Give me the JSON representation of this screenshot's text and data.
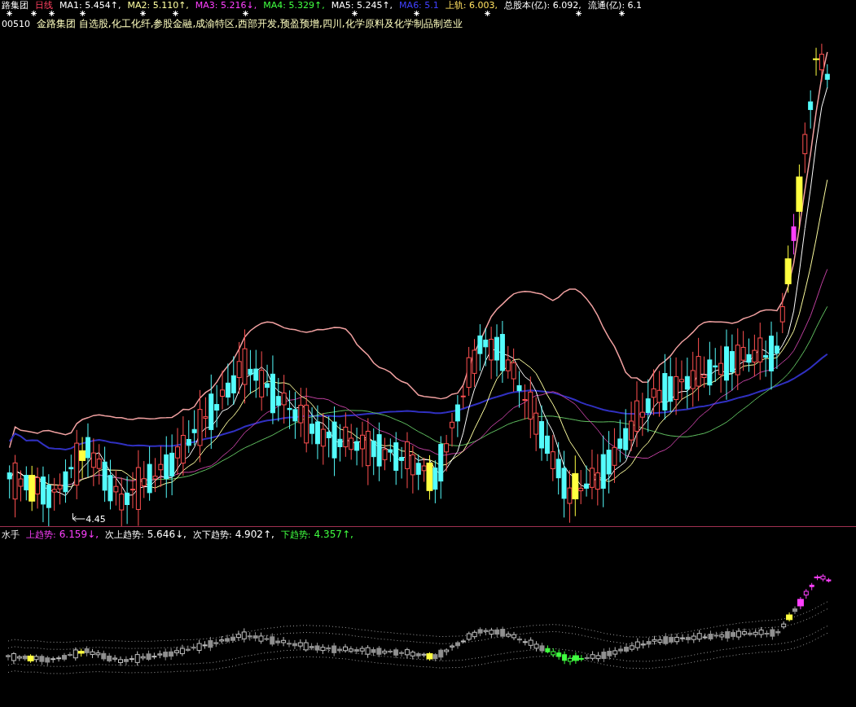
{
  "legend": {
    "title": "路集团",
    "period": "日线",
    "items": [
      {
        "text": "MA1: 5.454↑,",
        "color": "#ffffff"
      },
      {
        "text": "MA2: 5.110↑,",
        "color": "#ffffa0"
      },
      {
        "text": "MA3: 5.216↓,",
        "color": "#ff40ff"
      },
      {
        "text": "MA4: 5.329↑,",
        "color": "#40ff40"
      },
      {
        "text": "MA5: 5.245↑,",
        "color": "#ffffff"
      },
      {
        "text": "MA6: 5.1",
        "color": "#4040ff"
      },
      {
        "text": "上轨: 6.003,",
        "color": "#ffe060"
      },
      {
        "text": "总股本(亿): 6.092,",
        "color": "#ffffff"
      },
      {
        "text": "流通(亿): 6.1",
        "color": "#ffffff"
      }
    ]
  },
  "info": {
    "code": "00510",
    "text": "金路集团 自选股,化工化纤,参股金融,成渝特区,西部开发,预盈预增,四川,化学原料及化学制品制造业"
  },
  "price_marker": "4.45",
  "indicator": {
    "name": "水手",
    "items": [
      {
        "label": "上趋势:",
        "value": "6.159↓,",
        "color": "#ff40ff"
      },
      {
        "label": "次上趋势:",
        "value": "5.646↓,",
        "color": "#ffffff"
      },
      {
        "label": "次下趋势:",
        "value": "4.902↑,",
        "color": "#ffffff"
      },
      {
        "label": "下趋势:",
        "value": "4.357↑,",
        "color": "#40ff40"
      }
    ]
  }
}
